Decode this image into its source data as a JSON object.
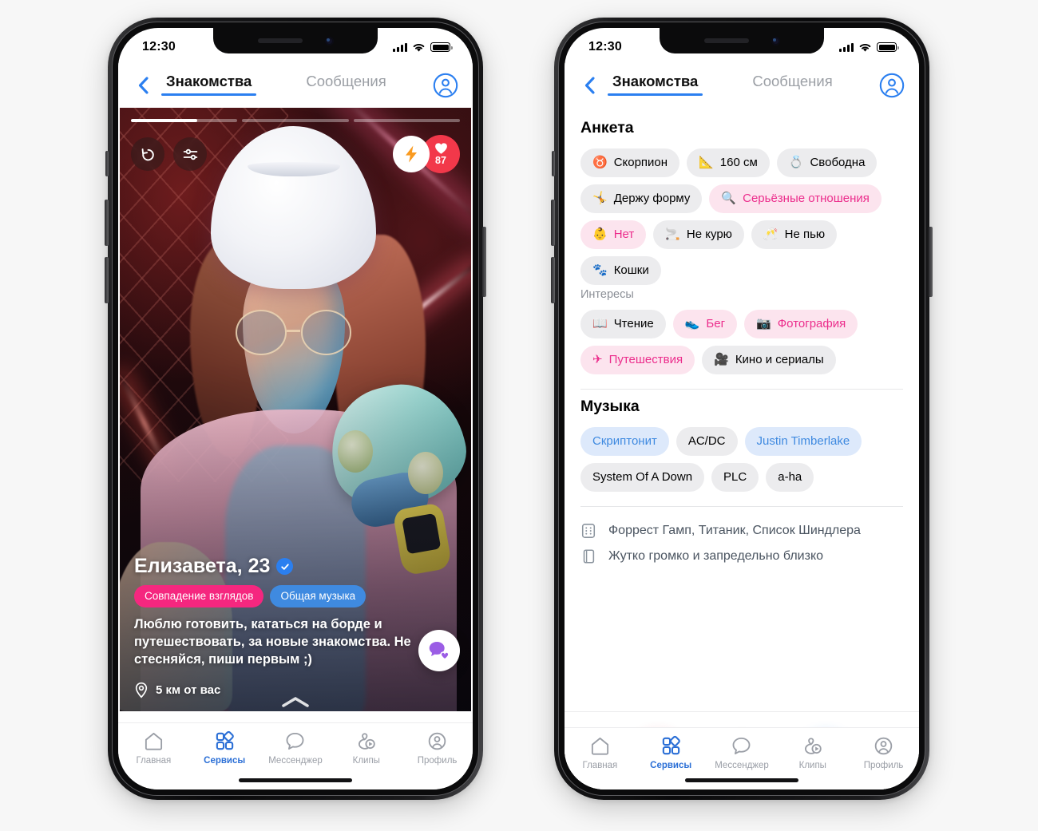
{
  "status_bar": {
    "time": "12:30",
    "signal_icon": "cellular-bars-icon",
    "wifi_icon": "wifi-icon",
    "battery_icon": "battery-icon"
  },
  "header": {
    "back_icon": "chevron-left-icon",
    "tab_dating": "Знакомства",
    "tab_messages": "Сообщения",
    "profile_icon": "account-circle-icon"
  },
  "card": {
    "progress": {
      "segments": 3,
      "active_index": 0,
      "active_fill_percent": 62
    },
    "rewind_icon": "rewind-arrow-icon",
    "filters_icon": "sliders-icon",
    "boost_icon": "lightning-bolt-icon",
    "likes_icon": "heart-icon",
    "likes_count": "87",
    "name": "Елизавета, 23",
    "verified_icon": "verified-check-icon",
    "badges": [
      {
        "label": "Совпадение взглядов",
        "color": "#f5277f"
      },
      {
        "label": "Общая музыка",
        "color": "#3f8ae0"
      }
    ],
    "bio": "Люблю готовить, кататься на борде и путешествовать, за новые знакомства. Не стесняйся, пиши первым ;)",
    "geo_icon": "location-pin-icon",
    "geo": "5 км от вас",
    "expand_icon": "chevron-up-icon",
    "chat_fab_icon": "chat-heart-icon"
  },
  "profile": {
    "anketa_title": "Анкета",
    "anketa_chips": [
      {
        "emoji": "♉",
        "label": "Скорпион",
        "style": "grey",
        "icon": "zodiac-icon"
      },
      {
        "emoji": "📐",
        "label": "160 см",
        "style": "grey",
        "icon": "ruler-icon"
      },
      {
        "emoji": "💍",
        "label": "Свободна",
        "style": "grey",
        "icon": "ring-icon"
      },
      {
        "emoji": "🤸",
        "label": "Держу форму",
        "style": "grey",
        "icon": "fitness-icon"
      },
      {
        "emoji": "🔍",
        "label": "Серьёзные отношения",
        "style": "pink",
        "icon": "magnifier-icon"
      },
      {
        "emoji": "👶",
        "label": "Нет",
        "style": "pink",
        "icon": "baby-icon"
      },
      {
        "emoji": "🚬",
        "label": "Не курю",
        "style": "grey",
        "icon": "cigarette-icon"
      },
      {
        "emoji": "🥂",
        "label": "Не пью",
        "style": "grey",
        "icon": "champagne-icon"
      },
      {
        "emoji": "🐾",
        "label": "Кошки",
        "style": "grey",
        "icon": "paws-icon"
      }
    ],
    "interests_title": "Интересы",
    "interest_chips": [
      {
        "emoji": "📖",
        "label": "Чтение",
        "style": "grey",
        "icon": "book-icon"
      },
      {
        "emoji": "👟",
        "label": "Бег",
        "style": "pink",
        "icon": "sneaker-icon"
      },
      {
        "emoji": "📷",
        "label": "Фотография",
        "style": "pink",
        "icon": "camera-icon"
      },
      {
        "emoji": "✈",
        "label": "Путешествия",
        "style": "pink",
        "icon": "airplane-icon"
      },
      {
        "emoji": "🎥",
        "label": "Кино и сериалы",
        "style": "grey",
        "icon": "movie-camera-icon"
      }
    ],
    "music_title": "Музыка",
    "music_chips": [
      {
        "label": "Скриптонит",
        "style": "blue"
      },
      {
        "label": "AC/DC",
        "style": "grey"
      },
      {
        "label": "Justin Timberlake",
        "style": "blue"
      },
      {
        "label": "System Of A Down",
        "style": "grey"
      },
      {
        "label": "PLC",
        "style": "grey"
      },
      {
        "label": "a-ha",
        "style": "grey"
      }
    ],
    "rows": [
      {
        "icon": "film-reel-icon",
        "text": "Форрест Гамп, Титаник, Список Шиндлера"
      },
      {
        "icon": "book-outline-icon",
        "text": "Жутко громко и запредельно близко"
      }
    ],
    "actions": {
      "dislike_icon": "close-x-icon",
      "dislike_color": "#f2283c",
      "message_icon": "chat-heart-icon",
      "like_icon": "check-icon",
      "like_color": "#2b7ff0"
    }
  },
  "tabbar": {
    "items": [
      {
        "label": "Главная",
        "icon": "home-icon",
        "active": false
      },
      {
        "label": "Сервисы",
        "icon": "services-grid-icon",
        "active": true
      },
      {
        "label": "Мессенджер",
        "icon": "message-bubble-icon",
        "active": false
      },
      {
        "label": "Клипы",
        "icon": "clips-icon",
        "active": false
      },
      {
        "label": "Профиль",
        "icon": "account-circle-icon",
        "active": false
      }
    ]
  },
  "colors": {
    "accent_blue": "#2b7ff0",
    "accent_pink": "#f5277f",
    "chip_pink_text": "#ec2d8c",
    "chip_blue_text": "#3f8ae0",
    "red": "#f2283c"
  }
}
